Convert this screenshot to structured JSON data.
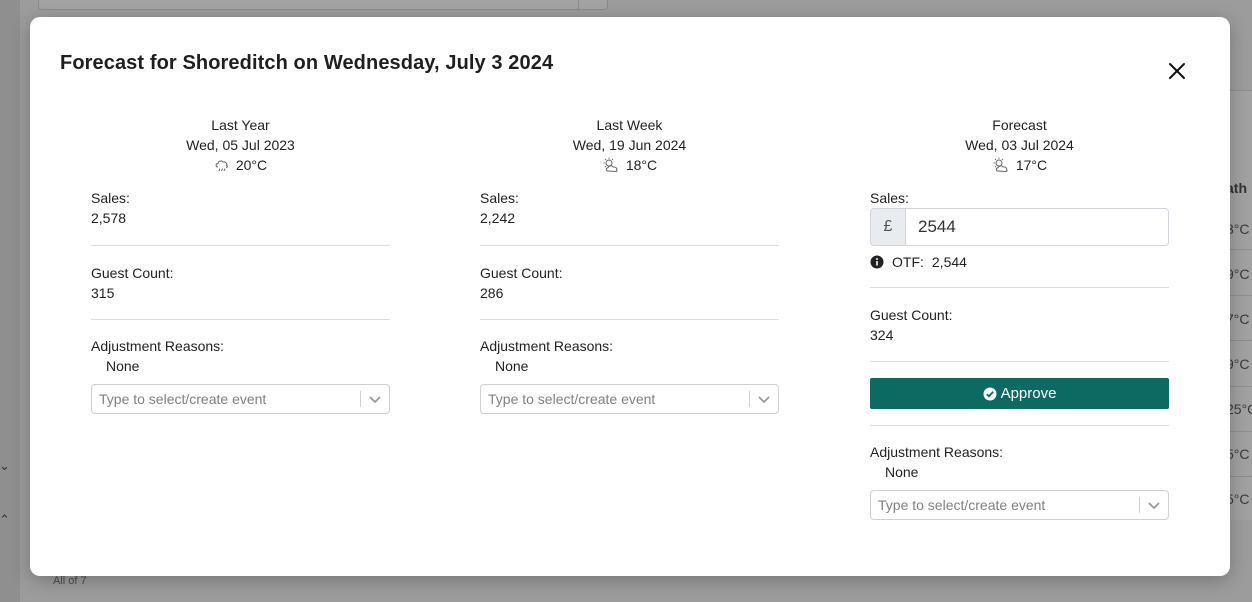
{
  "background": {
    "footer_text": "All of 7",
    "right_header": "ath",
    "right_temps": [
      "3°C",
      "9°C",
      "7°C",
      "9°C",
      "25°C",
      "5°C",
      "5°C"
    ]
  },
  "modal": {
    "title": "Forecast for Shoreditch on Wednesday, July 3 2024",
    "close_icon": "close-icon",
    "accent_color": "#0b6b63"
  },
  "columns": {
    "last_year": {
      "heading": "Last Year",
      "date": "Wed, 05 Jul 2023",
      "weather_icon": "rain-cloud-icon",
      "temperature": "20°C",
      "sales_label": "Sales:",
      "sales_value": "2,578",
      "guest_label": "Guest Count:",
      "guest_value": "315",
      "reasons_label": "Adjustment Reasons:",
      "reasons_value": "None",
      "event_placeholder": "Type to select/create event"
    },
    "last_week": {
      "heading": "Last Week",
      "date": "Wed, 19 Jun 2024",
      "weather_icon": "partly-cloudy-icon",
      "temperature": "18°C",
      "sales_label": "Sales:",
      "sales_value": "2,242",
      "guest_label": "Guest Count:",
      "guest_value": "286",
      "reasons_label": "Adjustment Reasons:",
      "reasons_value": "None",
      "event_placeholder": "Type to select/create event"
    },
    "forecast": {
      "heading": "Forecast",
      "date": "Wed, 03 Jul 2024",
      "weather_icon": "partly-cloudy-icon",
      "temperature": "17°C",
      "sales_label": "Sales:",
      "currency": "£",
      "sales_input_value": "2544",
      "otf_label": "OTF:",
      "otf_value": "2,544",
      "guest_label": "Guest Count:",
      "guest_value": "324",
      "approve_label": "Approve",
      "reasons_label": "Adjustment Reasons:",
      "reasons_value": "None",
      "event_placeholder": "Type to select/create event"
    }
  }
}
